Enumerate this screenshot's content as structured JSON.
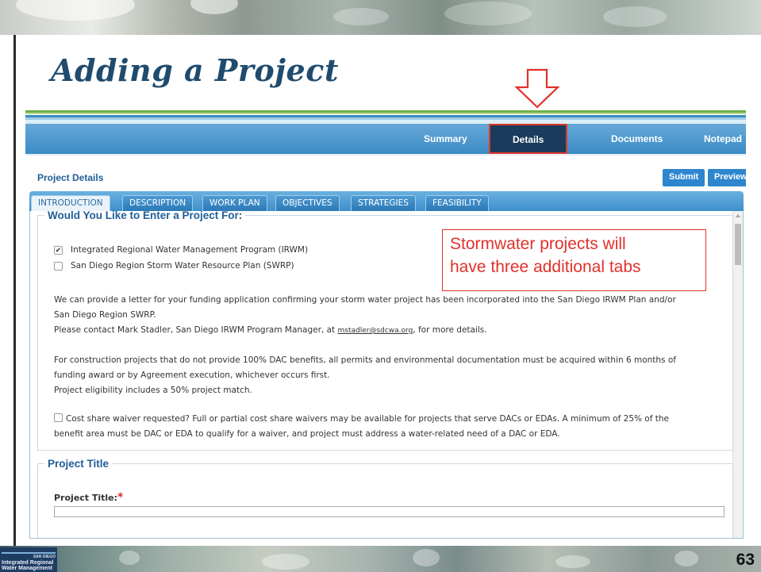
{
  "slide": {
    "title": "Adding a Project",
    "page_number": "63",
    "logo_text": [
      "SAN DIEGO",
      "Integrated Regional",
      "Water Management"
    ]
  },
  "nav": {
    "items": [
      "Summary",
      "Details",
      "Documents",
      "Notepad"
    ],
    "active": "Details"
  },
  "header": {
    "title": "Project Details",
    "submit_label": "Submit",
    "preview_label": "Preview"
  },
  "tabs": {
    "items": [
      "INTRODUCTION",
      "DESCRIPTION",
      "WORK PLAN",
      "OBJECTIVES",
      "STRATEGIES",
      "FEASIBILITY"
    ],
    "active": "INTRODUCTION"
  },
  "intro": {
    "legend": "Would You Like to Enter a Project For:",
    "options": [
      {
        "label": "Integrated Regional Water Management Program (IRWM)",
        "checked": true
      },
      {
        "label": "San Diego Region Storm Water Resource Plan (SWRP)",
        "checked": false
      }
    ],
    "para1_line1": "We can provide a letter for your funding application confirming your storm water project has been incorporated into the San Diego IRWM Plan and/or",
    "para1_line2": "San Diego Region SWRP.",
    "para1_line3_pre": "Please contact Mark Stadler, San Diego IRWM Program Manager, at",
    "email": "mstadler@sdcwa.org",
    "para1_line3_post": ", for more details.",
    "para2_line1": "For construction projects that do not provide 100% DAC benefits, all permits and environmental documentation must be acquired within 6 months of",
    "para2_line2": "funding award or by Agreement execution, whichever occurs first.",
    "para2_line3": "Project eligibility includes a 50% project match.",
    "waiver_line1": "Cost share waiver requested? Full or partial cost share waivers may be available for projects that serve DACs or EDAs. A minimum of 25% of the",
    "waiver_line2": "benefit area must be DAC or EDA to qualify for a waiver, and project must address a water-related need of a DAC or EDA.",
    "waiver_checked": false
  },
  "project_title": {
    "legend": "Project Title",
    "label": "Project Title:",
    "required_mark": "*",
    "value": ""
  },
  "callout": {
    "line1": "Stormwater projects will",
    "line2": "have three additional tabs"
  },
  "colors": {
    "title": "#1f4b6e",
    "nav_bar": "#3b8bc6",
    "nav_active": "#1a3b5b",
    "accent_red": "#e0312b",
    "link_blue": "#1f5e96",
    "button_blue": "#2e86cf"
  }
}
